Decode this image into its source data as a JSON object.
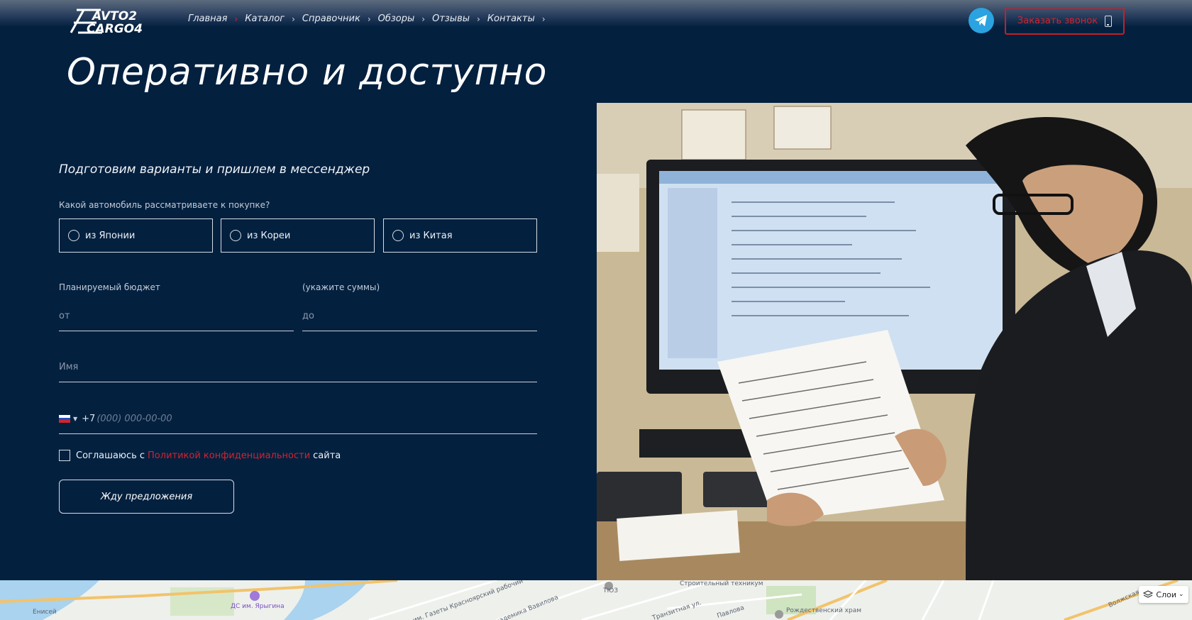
{
  "header": {
    "logo_text": "AVTO2 CARGO4",
    "nav": [
      {
        "label": "Главная"
      },
      {
        "label": "Каталог"
      },
      {
        "label": "Справочник"
      },
      {
        "label": "Обзоры"
      },
      {
        "label": "Отзывы"
      },
      {
        "label": "Контакты"
      }
    ],
    "callback_label": "Заказать звонок",
    "colors": {
      "accent": "#d3232f",
      "background": "#03203f",
      "telegram": "#2aa3e0"
    }
  },
  "hero": {
    "title": "Оперативно и доступно"
  },
  "form": {
    "subtitle": "Подготовим варианты и пришлем в мессенджер",
    "question": "Какой автомобиль рассматриваете к покупке?",
    "options": [
      {
        "label": "из Японии"
      },
      {
        "label": "из Кореи"
      },
      {
        "label": "из Китая"
      }
    ],
    "budget_label": "Планируемый бюджет",
    "budget_hint": "(укажите суммы)",
    "budget_from_placeholder": "от",
    "budget_to_placeholder": "до",
    "name_placeholder": "Имя",
    "phone_prefix": "+7",
    "phone_placeholder": "(000) 000-00-00",
    "agree_text_before": "Соглашаюсь с",
    "agree_link": "Политикой конфиденциальности",
    "agree_text_after": "сайта",
    "submit_label": "Жду предложения"
  },
  "map": {
    "labels": [
      "Енисей",
      "ДС им. Ярыгина",
      "просп. им. Газеты Красноярский рабочий",
      "Академика Вавилова",
      "ТЮЗ",
      "Строительный техникум",
      "Транзитная ул.",
      "Павлова",
      "Рождественский храм",
      "Волжская ул."
    ],
    "layers_label": "Слои"
  }
}
